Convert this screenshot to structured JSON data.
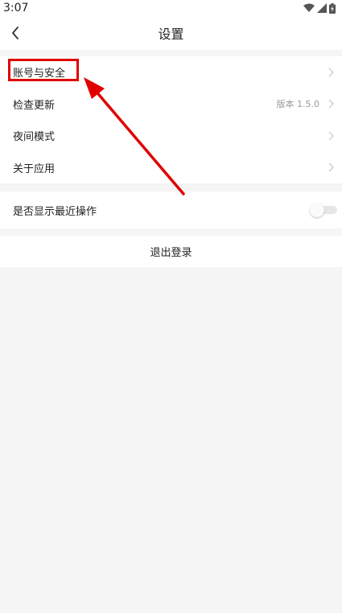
{
  "status_bar": {
    "time": "3:07",
    "icons": [
      "wifi-icon",
      "signal-icon",
      "battery-icon"
    ]
  },
  "nav": {
    "title": "设置",
    "back_icon": "chevron-left-icon"
  },
  "settings": {
    "account_security": {
      "label": "账号与安全"
    },
    "check_update": {
      "label": "检查更新",
      "value": "版本 1.5.0"
    },
    "night_mode": {
      "label": "夜间模式"
    },
    "about_app": {
      "label": "关于应用"
    }
  },
  "recent_actions": {
    "label": "是否显示最近操作",
    "enabled": false
  },
  "logout": {
    "label": "退出登录"
  },
  "colors": {
    "annotation_red": "#e00000",
    "background": "#f5f5f5",
    "surface": "#ffffff"
  }
}
